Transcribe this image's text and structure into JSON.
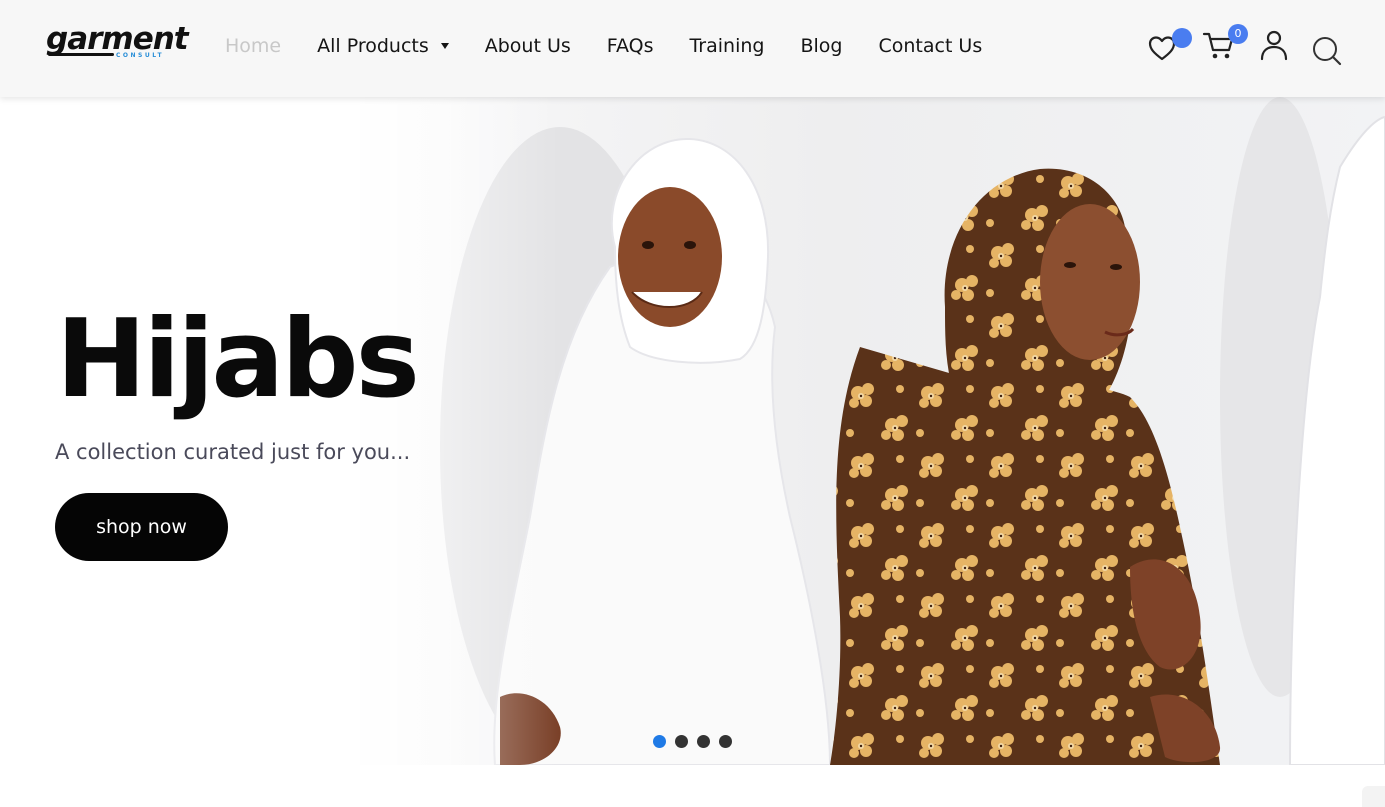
{
  "logo": {
    "main": "garment",
    "sub": "CONSULT"
  },
  "nav": {
    "items": [
      {
        "label": "Home",
        "active": true
      },
      {
        "label": "All Products",
        "dropdown": true
      },
      {
        "label": "About Us"
      },
      {
        "label": "FAQs"
      },
      {
        "label": "Training"
      },
      {
        "label": "Blog"
      },
      {
        "label": "Contact Us"
      }
    ]
  },
  "header_icons": {
    "wishlist": {
      "icon": "heart-icon"
    },
    "cart": {
      "icon": "cart-icon",
      "count": "0"
    },
    "account": {
      "icon": "user-icon"
    },
    "search": {
      "icon": "search-icon"
    }
  },
  "hero": {
    "title": "Hijabs",
    "subtitle": "A collection curated just for you...",
    "cta_label": "shop now",
    "slides_total": 4,
    "active_slide": 1
  },
  "colors": {
    "accent": "#4a7df0",
    "active_dot": "#1f7ae6",
    "button_bg": "#050505",
    "nav_inactive": "#c8c8c8"
  }
}
